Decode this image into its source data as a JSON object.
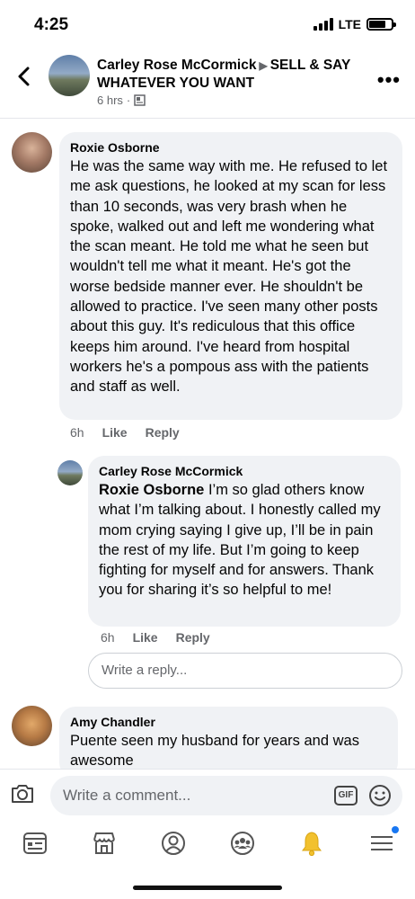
{
  "status_bar": {
    "time": "4:25",
    "network": "LTE",
    "battery_level": 0.75
  },
  "header": {
    "author": "Carley Rose McCormick",
    "group": "SELL & SAY WHATEVER YOU WANT",
    "time_ago": "6 hrs",
    "separator": "·"
  },
  "comments": [
    {
      "name": "Roxie Osborne",
      "text": "He was the same way with me. He refused to let me ask questions, he looked at my scan for less than 10 seconds, was very brash when he spoke, walked out and left me wondering what the scan meant. He told me what he seen but wouldn't tell me what it meant. He's got the worse bedside manner ever. He shouldn't be allowed to practice. I've seen many other posts about this guy. It's rediculous that this office keeps him around. I've heard from hospital workers he's a pompous ass with the patients and staff as well.",
      "time": "6h",
      "like": "Like",
      "reply": "Reply"
    },
    {
      "name": "Carley Rose McCormick",
      "mention": "Roxie Osborne",
      "text": " I’m so glad others know what I’m talking about. I honestly called my mom crying saying I give up, I’ll be in pain the rest of my life. But I’m going to keep fighting for myself and for answers. Thank you for sharing it’s so helpful to me!",
      "time": "6h",
      "like": "Like",
      "reply": "Reply"
    },
    {
      "name": "Amy Chandler",
      "text": "Puente seen my husband for years and was awesome"
    }
  ],
  "reply_placeholder": "Write a reply...",
  "comment_placeholder": "Write a comment...",
  "gif_label": "GIF",
  "icons": [
    "back-icon",
    "more-icon",
    "camera-icon",
    "gif-icon",
    "emoji-icon",
    "news-feed-icon",
    "marketplace-icon",
    "profile-icon",
    "groups-icon",
    "notifications-icon",
    "menu-icon"
  ],
  "colors": {
    "bubble": "#f0f2f5",
    "secondary_text": "#65676b",
    "accent": "#1877f2",
    "bell": "#f2c12e"
  }
}
